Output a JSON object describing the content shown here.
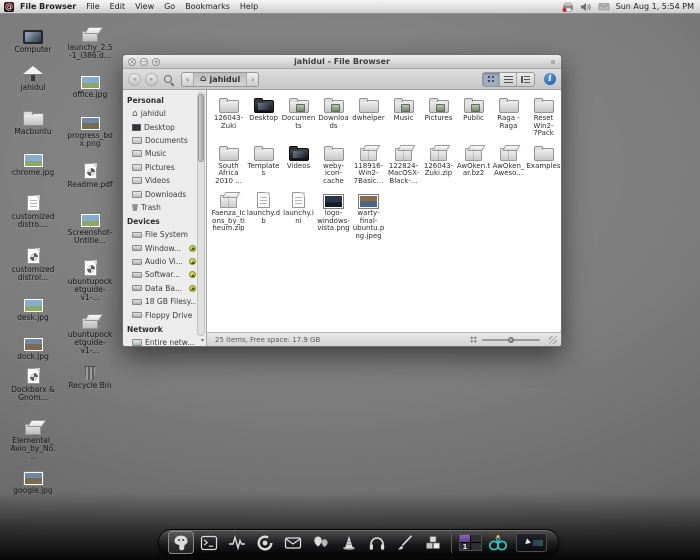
{
  "menubar": {
    "app_name": "File Browser",
    "menus": [
      "File",
      "Edit",
      "View",
      "Go",
      "Bookmarks",
      "Help"
    ],
    "tray_icons": [
      "printer-icon",
      "volume-icon",
      "mail-icon"
    ],
    "clock": "Sun Aug 1, 5:54 PM"
  },
  "desktop": {
    "col1": [
      {
        "label": "Computer",
        "icon": "computer"
      },
      {
        "label": "jahidul",
        "icon": "home"
      },
      {
        "label": "Macbuntu",
        "icon": "folder"
      },
      {
        "label": "chrome.jpg",
        "icon": "image"
      },
      {
        "label": "customized distro....",
        "icon": "text-document"
      },
      {
        "label": "customized distrol...",
        "icon": "pdf"
      },
      {
        "label": "desk.jpg",
        "icon": "image"
      },
      {
        "label": "dock.jpg",
        "icon": "image"
      },
      {
        "label": "Dockbarx & Gnom...",
        "icon": "pdf"
      },
      {
        "label": "Elemental_Avio_by_No...",
        "icon": "package"
      },
      {
        "label": "google.jpg",
        "icon": "image"
      }
    ],
    "col2": [
      {
        "label": "launchy_2.5-1_i386.d...",
        "icon": "package"
      },
      {
        "label": "office.jpg",
        "icon": "image"
      },
      {
        "label": "progress_box.png",
        "icon": "image"
      },
      {
        "label": "Readme.pdf",
        "icon": "pdf"
      },
      {
        "label": "Screenshot-Untitle...",
        "icon": "image"
      },
      {
        "label": "ubuntupocketguide-v1-...",
        "icon": "pdf"
      },
      {
        "label": "ubuntupocketguide-v1-...",
        "icon": "package"
      },
      {
        "label": "Recycle Bin",
        "icon": "trash"
      }
    ]
  },
  "window": {
    "title": "jahidul - File Browser",
    "breadcrumb": "jahidul",
    "sidebar": {
      "personal_header": "Personal",
      "personal": [
        "jahidul",
        "Desktop",
        "Documents",
        "Music",
        "Pictures",
        "Videos",
        "Downloads",
        "Trash"
      ],
      "devices_header": "Devices",
      "devices": [
        {
          "label": "File System",
          "eject": false
        },
        {
          "label": "Window...",
          "eject": true
        },
        {
          "label": "Audio Vi...",
          "eject": true
        },
        {
          "label": "Softwar...",
          "eject": true
        },
        {
          "label": "Data Ba...",
          "eject": true
        },
        {
          "label": "18 GB Filesy...",
          "eject": false
        },
        {
          "label": "Floppy Drive",
          "eject": false
        }
      ],
      "network_header": "Network",
      "network": [
        "Entire netw..."
      ]
    },
    "files": [
      {
        "label": "126043-Zuki",
        "icon": "folder"
      },
      {
        "label": "Desktop",
        "icon": "folder-dark"
      },
      {
        "label": "Documents",
        "icon": "folder-emblem"
      },
      {
        "label": "Downloads",
        "icon": "folder-emblem"
      },
      {
        "label": "dwhelper",
        "icon": "folder"
      },
      {
        "label": "Music",
        "icon": "folder-emblem"
      },
      {
        "label": "Pictures",
        "icon": "folder-emblem"
      },
      {
        "label": "Public",
        "icon": "folder-emblem"
      },
      {
        "label": "Raga - Raga",
        "icon": "folder"
      },
      {
        "label": "Reset Win2-7Pack",
        "icon": "folder"
      },
      {
        "label": "South Africa 2010 ...",
        "icon": "folder"
      },
      {
        "label": "Templates",
        "icon": "folder"
      },
      {
        "label": "Videos",
        "icon": "folder-dark"
      },
      {
        "label": "weby-icon-cache",
        "icon": "folder"
      },
      {
        "label": "118916-Win2-7Basic...",
        "icon": "archive"
      },
      {
        "label": "122824-MacOSX-Black-...",
        "icon": "archive"
      },
      {
        "label": "126043-Zuki.zip",
        "icon": "archive"
      },
      {
        "label": "AwOken.tar.bz2",
        "icon": "archive"
      },
      {
        "label": "AwOken_Aweso...",
        "icon": "archive"
      },
      {
        "label": "Examples",
        "icon": "folder"
      },
      {
        "label": "Faenza_Icons_by_tiheum.zip",
        "icon": "archive"
      },
      {
        "label": "launchy.db",
        "icon": "text-file"
      },
      {
        "label": "launchy.ini",
        "icon": "text-file"
      },
      {
        "label": "logo-windows-vista.png",
        "icon": "image-dark"
      },
      {
        "label": "warty-final-ubuntu.png.jpeg",
        "icon": "image-warm"
      }
    ],
    "statusbar": "25 items, Free space: 17.9 GB"
  },
  "dock": {
    "items": [
      "gimp-icon",
      "terminal-icon",
      "activity-monitor-icon",
      "firefox-icon",
      "mail-icon",
      "balloons-icon",
      "vlc-cone-icon",
      "headphones-icon",
      "paintbrush-icon",
      "packages-icon",
      "workspace-pager",
      "butterfly-icon",
      "window-preview"
    ],
    "workspace": "1"
  },
  "colors": {
    "info_button": "#1b57a8",
    "eject_button": "#a9b13c",
    "pager_active": "#8a63c0",
    "butterfly": "#35c4c4"
  }
}
